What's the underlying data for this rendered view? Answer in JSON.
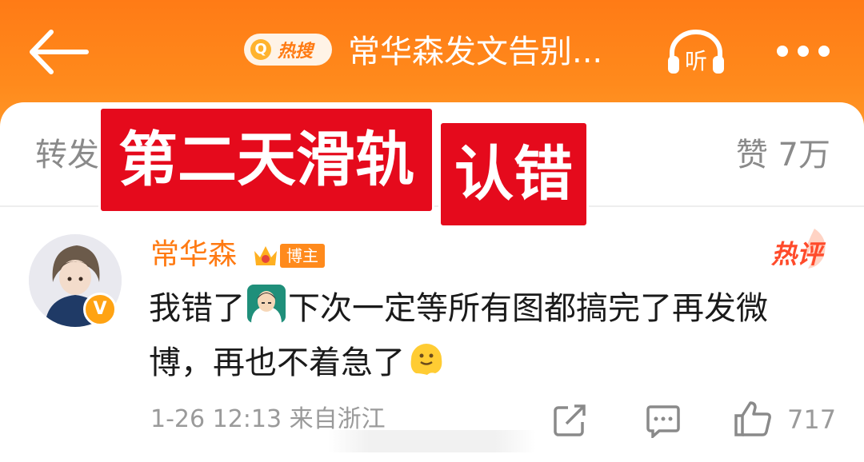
{
  "header": {
    "back_icon": "back-arrow-icon",
    "hot_badge": "热搜",
    "title": "常华森发文告别...",
    "listen_label": "听",
    "more_icon": "more-dots-icon"
  },
  "tabs": {
    "forward": "转发",
    "likes": "赞 7万"
  },
  "overlay": {
    "caption_1": "第二天滑轨",
    "caption_2": "认错"
  },
  "comment": {
    "username": "常华森",
    "badge": "博主",
    "hot_label": "热评",
    "text_part1": "我错了",
    "text_part2": "下次一定等所有图都搞完了再发微博，再也不着急了",
    "emoji_1": "face-palm-emoji",
    "emoji_2": "melting-face-emoji",
    "meta": "1-26 12:13 来自浙江",
    "like_count": "717"
  },
  "colors": {
    "header_orange": "#ff7b16",
    "overlay_red": "#e50a1c",
    "username_orange": "#ff7a12",
    "hot_red": "#ff4b2b"
  }
}
